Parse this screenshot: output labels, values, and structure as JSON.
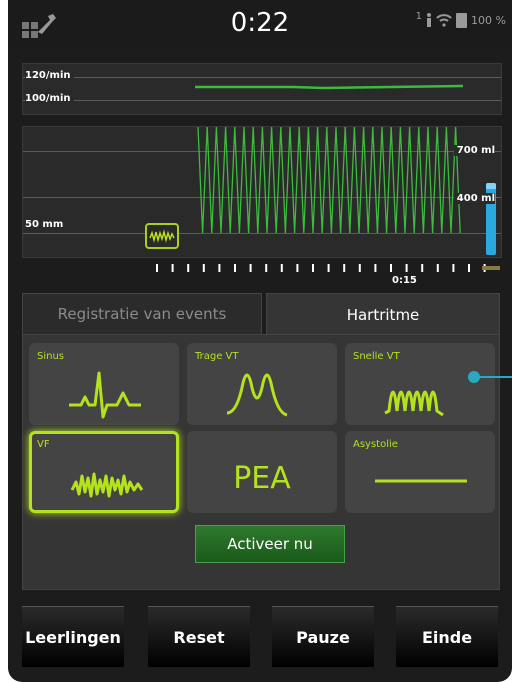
{
  "status": {
    "timer": "0:22",
    "signal_sub": "1",
    "battery": "100 %"
  },
  "rate_chart": {
    "labels": [
      "120/min",
      "100/min"
    ]
  },
  "wave_chart": {
    "depth_label": "50 mm",
    "volume_labels": [
      "700 ml",
      "400 ml"
    ],
    "time_marker": "0:15"
  },
  "tabs": {
    "events": "Registratie van events",
    "heart_rhythm": "Hartritme"
  },
  "rhythms": [
    {
      "label": "Sinus"
    },
    {
      "label": "Trage VT"
    },
    {
      "label": "Snelle VT"
    },
    {
      "label": "VF"
    },
    {
      "label": "PEA"
    },
    {
      "label": "Asystolie"
    }
  ],
  "activate_button": "Activeer nu",
  "bottom_buttons": {
    "students": "Leerlingen",
    "reset": "Reset",
    "pause": "Pauze",
    "end": "Einde"
  },
  "colors": {
    "accent": "#b4e21d",
    "wave": "#3dbb3d",
    "volume": "#2aa8e0"
  }
}
